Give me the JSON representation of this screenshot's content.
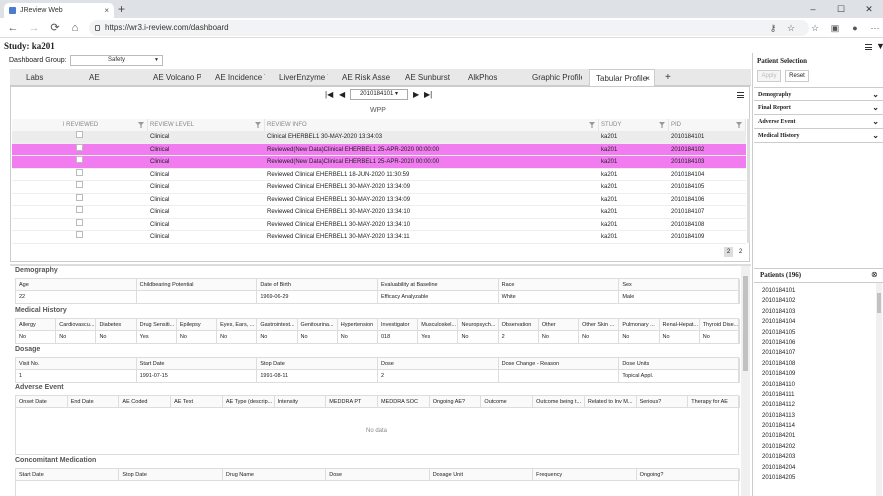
{
  "browser": {
    "tab_title": "JReview Web",
    "tab_close": "×",
    "new_tab": "+",
    "url": "https://wr3.i-review.com/dashboard",
    "win_min": "–",
    "win_max": "☐",
    "win_close": "✕"
  },
  "study": {
    "label": "Study: ka201"
  },
  "dashboard": {
    "group_label": "Dashboard Group:",
    "group_value": "Safety",
    "tabs": [
      "Labs",
      "AE",
      "AE Volcano Pk",
      "AE Incidence T",
      "LiverEnzyme T",
      "AE Risk Asses",
      "AE Sunburst",
      "AlkPhos",
      "Graphic Profile",
      "Tabular Profile"
    ],
    "tab_close": "×",
    "add_tab": "+"
  },
  "pager": {
    "first": "|◀",
    "prev": "◀",
    "current": "2010184101",
    "next": "▶",
    "last": "▶|"
  },
  "panel_title": "WPP",
  "grid": {
    "columns": [
      "I REVIEWED",
      "REVIEW LEVEL",
      "REVIEW INFO",
      "STUDY",
      "PID"
    ],
    "rows": [
      {
        "level": "Clinical",
        "info": "Clinical EHERBEL1 30-MAY-2020 13:34:03",
        "study": "ka201",
        "pid": "2010184101",
        "state": "first"
      },
      {
        "level": "Clinical",
        "info": "Reviewed(New Data)Clinical EHERBEL1 25-APR-2020 00:00:00",
        "study": "ka201",
        "pid": "2010184102",
        "state": "sel"
      },
      {
        "level": "Clinical",
        "info": "Reviewed(New Data)Clinical EHERBEL1 25-APR-2020 00:00:00",
        "study": "ka201",
        "pid": "2010184103",
        "state": "sel"
      },
      {
        "level": "Clinical",
        "info": "Reviewed Clinical EHERBEL1 18-JUN-2020 11:30:59",
        "study": "ka201",
        "pid": "2010184104",
        "state": ""
      },
      {
        "level": "Clinical",
        "info": "Reviewed Clinical EHERBEL1 30-MAY-2020 13:34:09",
        "study": "ka201",
        "pid": "2010184105",
        "state": ""
      },
      {
        "level": "Clinical",
        "info": "Reviewed Clinical EHERBEL1 30-MAY-2020 13:34:09",
        "study": "ka201",
        "pid": "2010184106",
        "state": ""
      },
      {
        "level": "Clinical",
        "info": "Reviewed Clinical EHERBEL1 30-MAY-2020 13:34:10",
        "study": "ka201",
        "pid": "2010184107",
        "state": ""
      },
      {
        "level": "Clinical",
        "info": "Reviewed Clinical EHERBEL1 30-MAY-2020 13:34:10",
        "study": "ka201",
        "pid": "2010184108",
        "state": ""
      },
      {
        "level": "Clinical",
        "info": "Reviewed Clinical EHERBEL1 30-MAY-2020 13:34:11",
        "study": "ka201",
        "pid": "2010184109",
        "state": ""
      }
    ],
    "pages": [
      "2",
      "2"
    ]
  },
  "demography": {
    "title": "Demography",
    "headers": [
      "Age",
      "Childbearing Potential",
      "Date of Birth",
      "Evaluability at Baseline",
      "Race",
      "Sex"
    ],
    "values": [
      "22",
      "",
      "1969-06-29",
      "Efficacy Analyzable",
      "White",
      "Male"
    ]
  },
  "medical_history": {
    "title": "Medical History",
    "headers": [
      "Allergy",
      "Cardiovascu...",
      "Diabetes",
      "Drug Sensiti...",
      "Epilepsy",
      "Eyes, Ears, ...",
      "Gastrointest...",
      "Genitourina...",
      "Hypertension",
      "Investigator",
      "Musculoskel...",
      "Neuropsych...",
      "Observation",
      "Other",
      "Other Skin ...",
      "Pulmonary ...",
      "Renal-Hepat...",
      "Thyroid Dise..."
    ],
    "values": [
      "No",
      "No",
      "No",
      "Yes",
      "No",
      "No",
      "No",
      "No",
      "No",
      "018",
      "Yes",
      "No",
      "2",
      "No",
      "No",
      "No",
      "No",
      "No"
    ]
  },
  "dosage": {
    "title": "Dosage",
    "headers": [
      "Visit No.",
      "Start Date",
      "Stop Date",
      "Dose",
      "Dose Change - Reason",
      "Dose Units"
    ],
    "values": [
      "1",
      "1991-07-15",
      "1991-08-11",
      "2",
      "",
      "Topical Appl."
    ]
  },
  "adverse_event": {
    "title": "Adverse Event",
    "headers": [
      "Onset Date",
      "End Date",
      "AE Coded",
      "AE Text",
      "AE Type (descrip...",
      "Intensity",
      "MEDDRA PT",
      "MEDDRA SOC",
      "Ongoing AE?",
      "Outcome",
      "Outcome being t...",
      "Related to Inv M...",
      "Serious?",
      "Therapy for AE"
    ],
    "no_data": "No data"
  },
  "concomitant": {
    "title": "Concomitant Medication",
    "headers": [
      "Start Date",
      "Stop Date",
      "Drug Name",
      "Dose",
      "Dosage Unit",
      "Frequency",
      "Ongoing?"
    ]
  },
  "patient_selection": {
    "title": "Patient Selection",
    "apply": "Apply",
    "reset": "Reset",
    "sections": [
      "Demography",
      "Final Report",
      "Adverse Event",
      "Medical History"
    ]
  },
  "patients": {
    "title": "Patients (196)",
    "close": "⊗",
    "ids": [
      "2010184101",
      "2010184102",
      "2010184103",
      "2010184104",
      "2010184105",
      "2010184106",
      "2010184107",
      "2010184108",
      "2010184109",
      "2010184110",
      "2010184111",
      "2010184112",
      "2010184113",
      "2010184114",
      "2010184201",
      "2010184202",
      "2010184203",
      "2010184204",
      "2010184205"
    ]
  },
  "colors": {
    "selected_row": "#f07cf0",
    "accent": "#4a7bd0"
  }
}
